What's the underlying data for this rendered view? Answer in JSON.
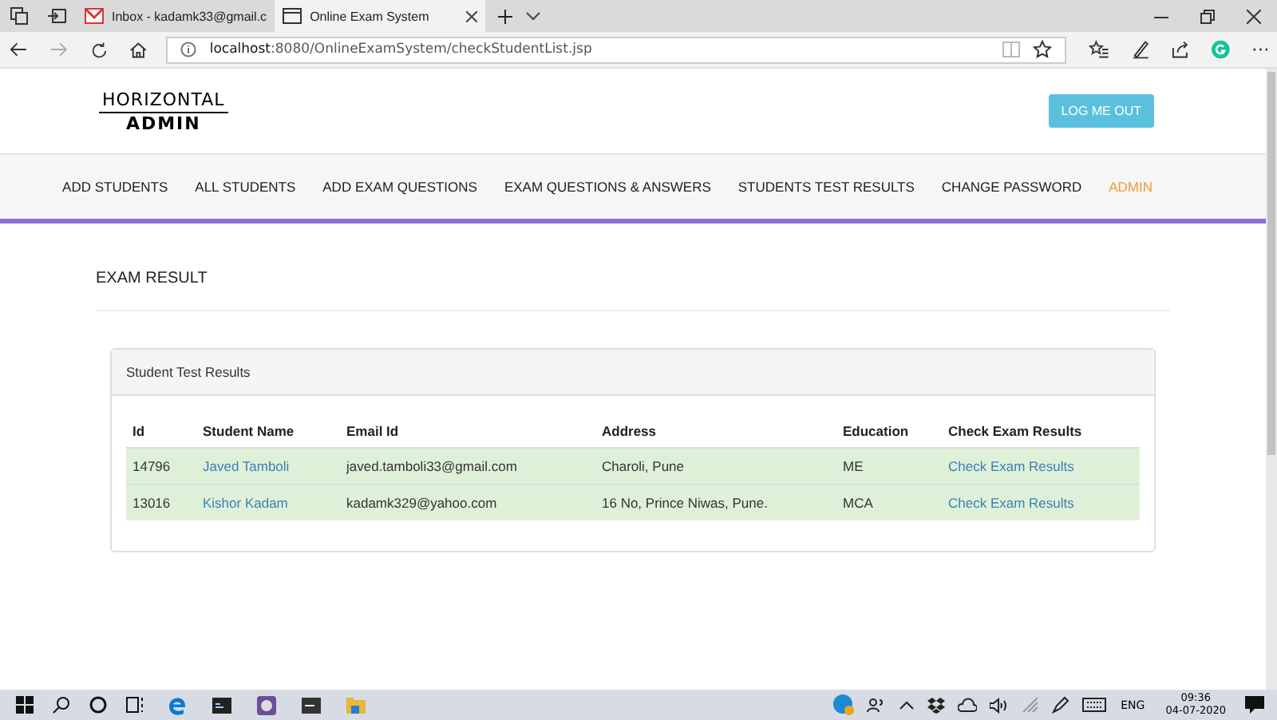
{
  "browser": {
    "tabs": [
      {
        "title": "Inbox - kadamk33@gmail.c",
        "selected": false
      },
      {
        "title": "Online Exam System",
        "selected": true
      }
    ],
    "address": {
      "host": "localhost",
      "path": ":8080/OnlineExamSystem/checkStudentList.jsp"
    }
  },
  "header": {
    "logo_top": "HORIZONTAL",
    "logo_bottom": "ADMIN",
    "logout": "LOG ME OUT"
  },
  "nav": [
    {
      "label": "ADD STUDENTS",
      "selected": false
    },
    {
      "label": "ALL STUDENTS",
      "selected": false
    },
    {
      "label": "ADD EXAM QUESTIONS",
      "selected": false
    },
    {
      "label": "EXAM QUESTIONS & ANSWERS",
      "selected": false
    },
    {
      "label": "STUDENTS TEST RESULTS",
      "selected": false
    },
    {
      "label": "CHANGE PASSWORD",
      "selected": false
    },
    {
      "label": "ADMIN",
      "selected": true
    }
  ],
  "page_title": "EXAM RESULT",
  "panel": {
    "title": "Student Test Results",
    "table": {
      "columns": [
        "Id",
        "Student Name",
        "Email Id",
        "Address",
        "Education",
        "Check Exam Results"
      ],
      "rows": [
        [
          "14796",
          "Javed Tamboli",
          "javed.tamboli33@gmail.com",
          "Charoli, Pune",
          "ME",
          "Check Exam Results"
        ],
        [
          "13016",
          "Kishor Kadam",
          "kadamk329@yahoo.com",
          "16 No, Prince Niwas, Pune.",
          "MCA",
          "Check Exam Results"
        ]
      ]
    }
  },
  "taskbar": {
    "language": "ENG",
    "time": "09:36",
    "date": "04-07-2020"
  }
}
